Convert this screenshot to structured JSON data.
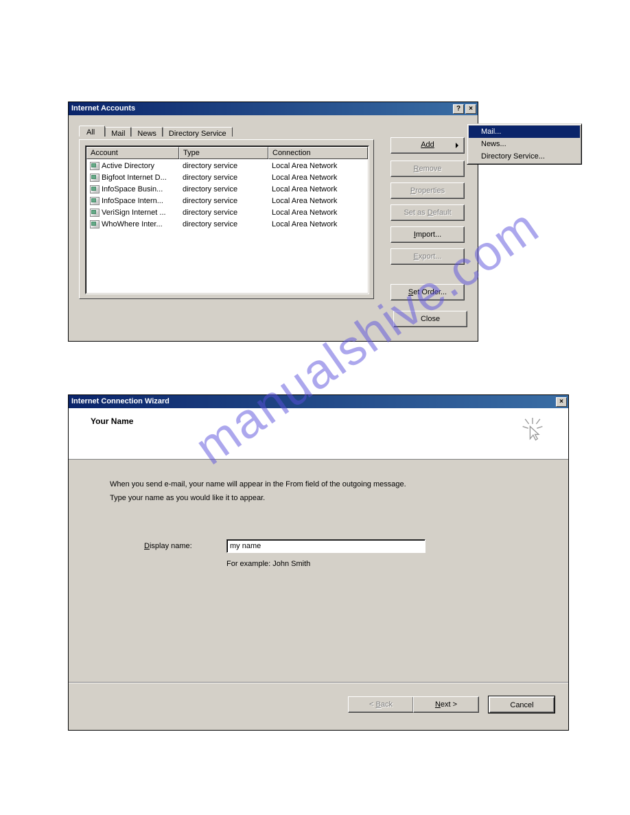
{
  "dialog1": {
    "title": "Internet Accounts",
    "tabs": [
      "All",
      "Mail",
      "News",
      "Directory Service"
    ],
    "active_tab": 0,
    "columns": [
      "Account",
      "Type",
      "Connection"
    ],
    "rows": [
      {
        "account": "Active Directory",
        "type": "directory service",
        "connection": "Local Area Network"
      },
      {
        "account": "Bigfoot Internet D...",
        "type": "directory service",
        "connection": "Local Area Network"
      },
      {
        "account": "InfoSpace Busin...",
        "type": "directory service",
        "connection": "Local Area Network"
      },
      {
        "account": "InfoSpace Intern...",
        "type": "directory service",
        "connection": "Local Area Network"
      },
      {
        "account": "VeriSign Internet ...",
        "type": "directory service",
        "connection": "Local Area Network"
      },
      {
        "account": "WhoWhere Inter...",
        "type": "directory service",
        "connection": "Local Area Network"
      }
    ],
    "buttons": {
      "add": "Add",
      "remove": "Remove",
      "properties": "Properties",
      "set_default": "Set as Default",
      "import": "Import...",
      "export": "Export...",
      "set_order": "Set Order...",
      "close": "Close"
    },
    "flyout": [
      "Mail...",
      "News...",
      "Directory Service..."
    ],
    "flyout_selected": 0
  },
  "dialog2": {
    "title": "Internet Connection Wizard",
    "subtitle": "Your Name",
    "instr1": "When you send e-mail, your name will appear in the From field of the outgoing message.",
    "instr2": "Type your name as you would like it to appear.",
    "label": "Display name:",
    "value": "my name",
    "example": "For example: John Smith",
    "back": "< Back",
    "next": "Next >",
    "cancel": "Cancel"
  },
  "watermark": "manualshive.com"
}
